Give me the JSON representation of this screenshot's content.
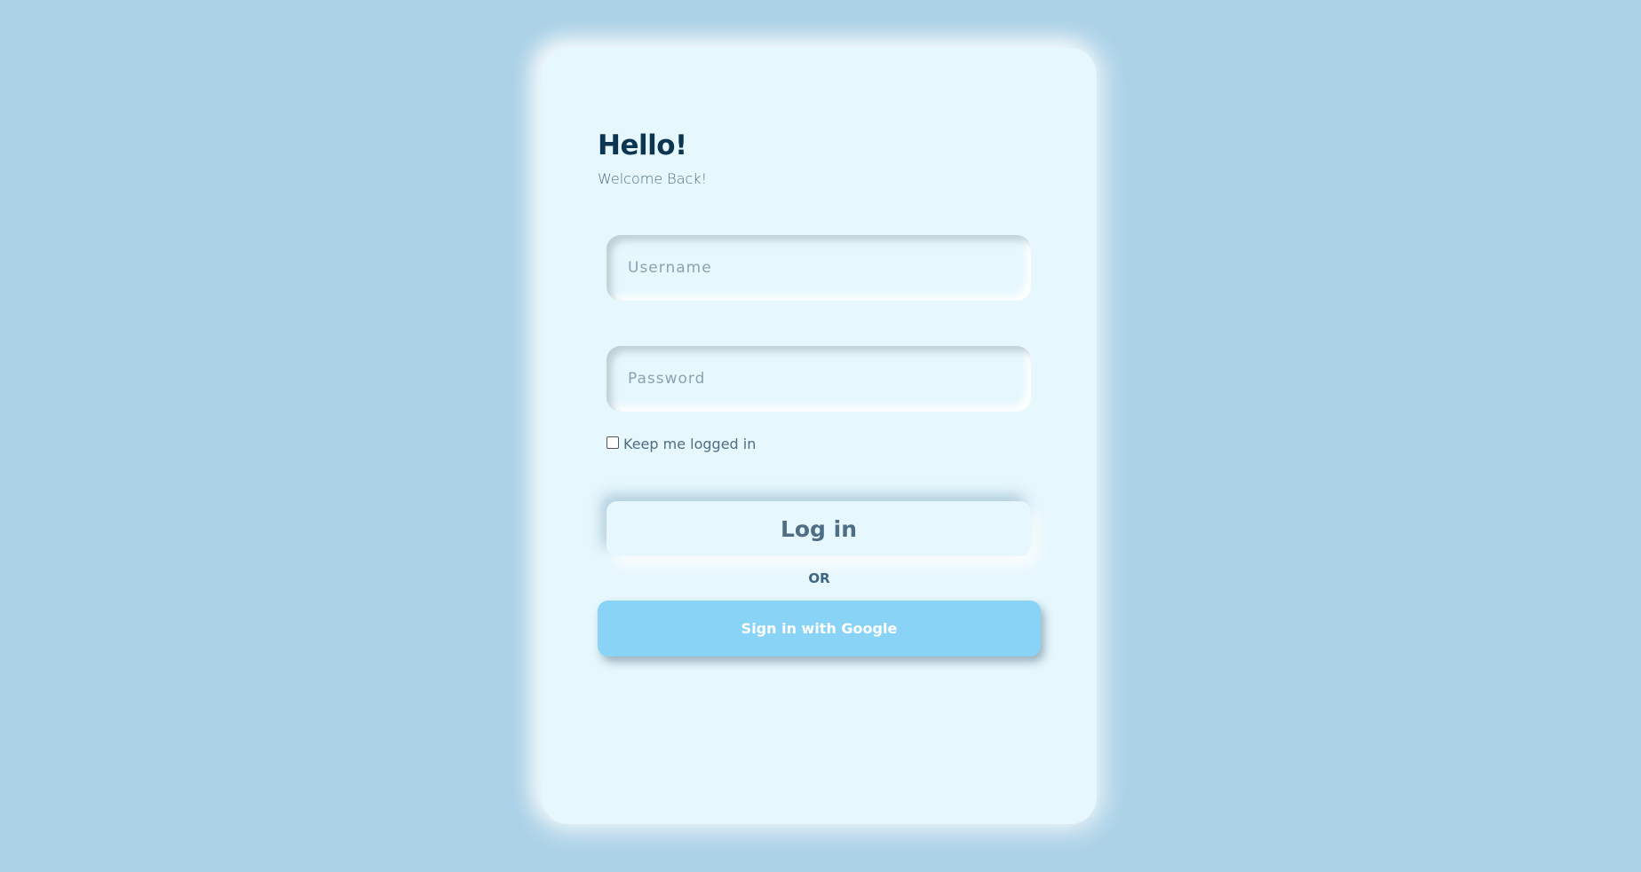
{
  "login": {
    "title": "Hello!",
    "subtitle": "Welcome Back!",
    "username_placeholder": "Username",
    "password_placeholder": "Password",
    "remember_label": "Keep me logged in",
    "remember_checked": false,
    "login_label": "Log in",
    "or_label": "OR",
    "google_label": "Sign in with Google"
  },
  "colors": {
    "background": "#acd2e7",
    "card": "#e6f7fd",
    "title": "#0b3551",
    "google_button": "#89d4f6"
  }
}
